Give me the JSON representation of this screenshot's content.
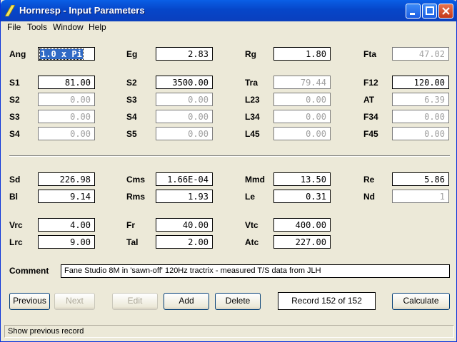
{
  "window": {
    "title": "Hornresp - Input Parameters"
  },
  "menu": {
    "file": "File",
    "tools": "Tools",
    "window": "Window",
    "help": "Help"
  },
  "fields": {
    "Ang": "1.0 x Pi",
    "Eg": "2.83",
    "Rg": "1.80",
    "Fta": "47.02",
    "S1": "81.00",
    "S2": "3500.00",
    "Tra": "79.44",
    "F12": "120.00",
    "S2b": "0.00",
    "S3": "0.00",
    "L23": "0.00",
    "AT": "6.39",
    "S3b": "0.00",
    "S4": "0.00",
    "L34": "0.00",
    "F34": "0.00",
    "S4b": "0.00",
    "S5": "0.00",
    "L45": "0.00",
    "F45": "0.00",
    "Sd": "226.98",
    "Cms": "1.66E-04",
    "Mmd": "13.50",
    "Re": "5.86",
    "Bl": "9.14",
    "Rms": "1.93",
    "Le": "0.31",
    "Nd": "1",
    "Vrc": "4.00",
    "Fr": "40.00",
    "Vtc": "400.00",
    "Lrc": "9.00",
    "Tal": "2.00",
    "Atc": "227.00"
  },
  "labels": {
    "Ang": "Ang",
    "Eg": "Eg",
    "Rg": "Rg",
    "Fta": "Fta",
    "S1": "S1",
    "S2": "S2",
    "Tra": "Tra",
    "F12": "F12",
    "S2b": "S2",
    "S3": "S3",
    "L23": "L23",
    "AT": "AT",
    "S3b": "S3",
    "S4": "S4",
    "L34": "L34",
    "F34": "F34",
    "S4b": "S4",
    "S5": "S5",
    "L45": "L45",
    "F45": "F45",
    "Sd": "Sd",
    "Cms": "Cms",
    "Mmd": "Mmd",
    "Re": "Re",
    "Bl": "Bl",
    "Rms": "Rms",
    "Le": "Le",
    "Nd": "Nd",
    "Vrc": "Vrc",
    "Fr": "Fr",
    "Vtc": "Vtc",
    "Lrc": "Lrc",
    "Tal": "Tal",
    "Atc": "Atc",
    "comment": "Comment"
  },
  "comment": "Fane Studio 8M in 'sawn-off' 120Hz tractrix - measured T/S data from JLH",
  "buttons": {
    "previous": "Previous",
    "next": "Next",
    "edit": "Edit",
    "add": "Add",
    "delete": "Delete",
    "calculate": "Calculate"
  },
  "record": "Record 152 of 152",
  "status": "Show previous record"
}
